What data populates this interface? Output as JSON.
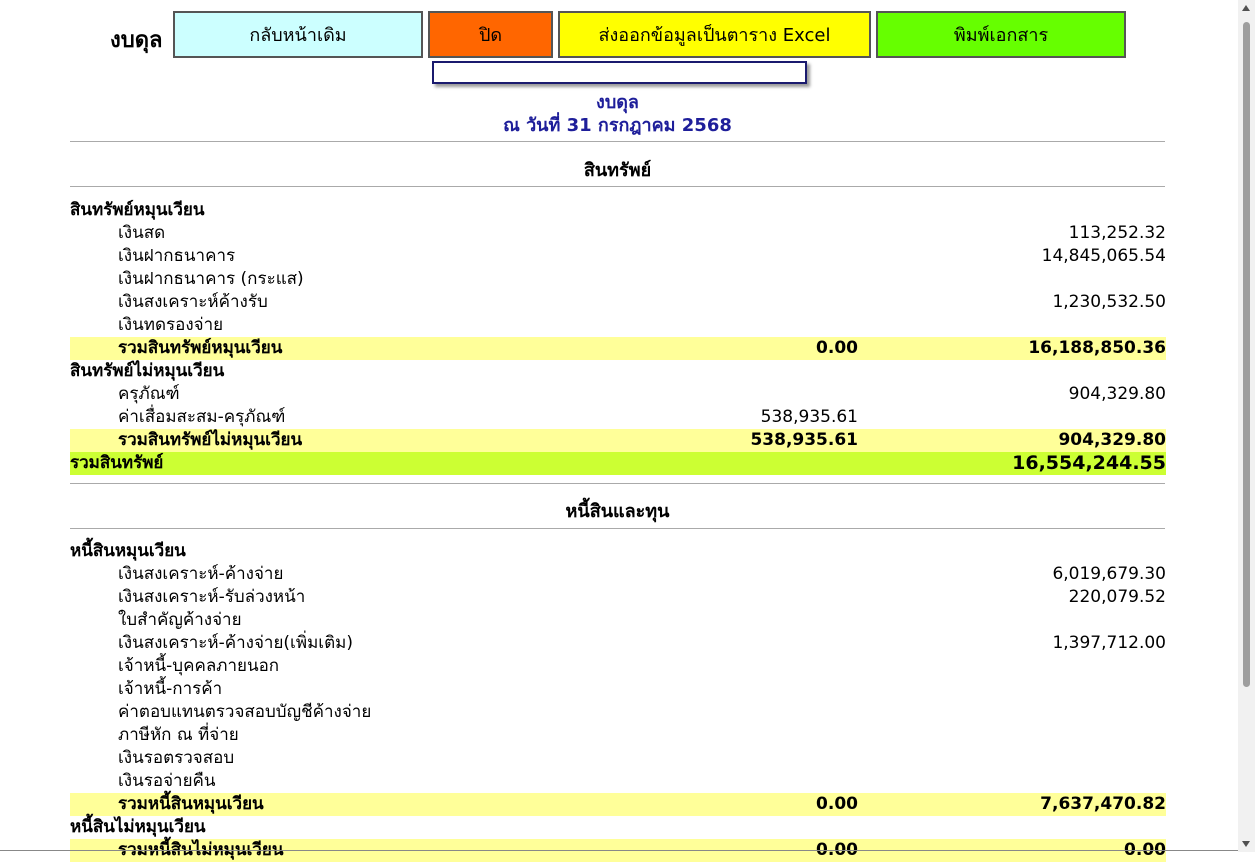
{
  "toolbar": {
    "label": "งบดุล",
    "back_label": "กลับหน้าเดิม",
    "close_label": "ปิด",
    "export_label": "ส่งออกข้อมูลเป็นตาราง Excel",
    "print_label": "พิมพ์เอกสาร",
    "back_color": "#ccffff",
    "close_color": "#ff6600",
    "export_color": "#ffff00",
    "print_color": "#66ff00"
  },
  "report": {
    "title": "งบดุล",
    "date": "ณ วันที่ 31 กรกฎาคม 2568"
  },
  "assets": {
    "heading": "สินทรัพย์",
    "current_header": "สินทรัพย์หมุนเวียน",
    "current_items": [
      {
        "label": "เงินสด",
        "c1": "",
        "c2": "113,252.32"
      },
      {
        "label": "เงินฝากธนาคาร",
        "c1": "",
        "c2": "14,845,065.54"
      },
      {
        "label": "เงินฝากธนาคาร (กระแส)",
        "c1": "",
        "c2": ""
      },
      {
        "label": "เงินสงเคราะห์ค้างรับ",
        "c1": "",
        "c2": "1,230,532.50"
      },
      {
        "label": "เงินทดรองจ่าย",
        "c1": "",
        "c2": ""
      }
    ],
    "current_total": {
      "label": "รวมสินทรัพย์หมุนเวียน",
      "c1": "0.00",
      "c2": "16,188,850.36"
    },
    "noncurrent_header": "สินทรัพย์ไม่หมุนเวียน",
    "noncurrent_items": [
      {
        "label": "ครุภัณฑ์",
        "c1": "",
        "c2": "904,329.80"
      },
      {
        "label": "ค่าเสื่อมสะสม-ครุภัณฑ์",
        "c1": "538,935.61",
        "c2": ""
      }
    ],
    "noncurrent_total": {
      "label": "รวมสินทรัพย์ไม่หมุนเวียน",
      "c1": "538,935.61",
      "c2": "904,329.80"
    },
    "grand_total": {
      "label": "รวมสินทรัพย์",
      "c2": "16,554,244.55"
    }
  },
  "liabilities": {
    "heading": "หนี้สินและทุน",
    "current_header": "หนี้สินหมุนเวียน",
    "current_items": [
      {
        "label": "เงินสงเคราะห์-ค้างจ่าย",
        "c1": "",
        "c2": "6,019,679.30"
      },
      {
        "label": "เงินสงเคราะห์-รับล่วงหน้า",
        "c1": "",
        "c2": "220,079.52"
      },
      {
        "label": "ใบสำคัญค้างจ่าย",
        "c1": "",
        "c2": ""
      },
      {
        "label": "เงินสงเคราะห์-ค้างจ่าย(เพิ่มเติม)",
        "c1": "",
        "c2": "1,397,712.00"
      },
      {
        "label": "เจ้าหนี้-บุคคลภายนอก",
        "c1": "",
        "c2": ""
      },
      {
        "label": "เจ้าหนี้-การค้า",
        "c1": "",
        "c2": ""
      },
      {
        "label": "ค่าตอบแทนตรวจสอบบัญชีค้างจ่าย",
        "c1": "",
        "c2": ""
      },
      {
        "label": "ภาษีหัก ณ ที่จ่าย",
        "c1": "",
        "c2": ""
      },
      {
        "label": "เงินรอตรวจสอบ",
        "c1": "",
        "c2": ""
      },
      {
        "label": "เงินรอจ่ายคืน",
        "c1": "",
        "c2": ""
      }
    ],
    "current_total": {
      "label": "รวมหนี้สินหมุนเวียน",
      "c1": "0.00",
      "c2": "7,637,470.82"
    },
    "noncurrent_header": "หนี้สินไม่หมุนเวียน",
    "noncurrent_total": {
      "label": "รวมหนี้สินไม่หมุนเวียน",
      "c1": "0.00",
      "c2": "0.00"
    }
  }
}
